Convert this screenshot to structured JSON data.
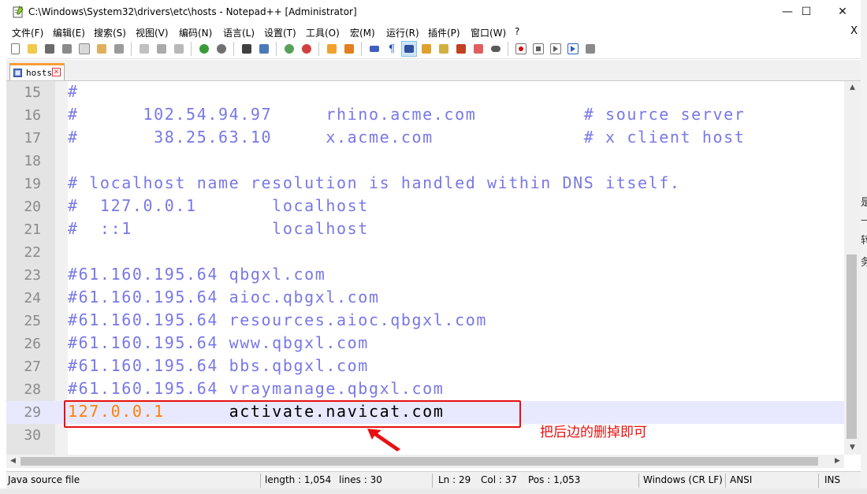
{
  "window": {
    "title": "C:\\Windows\\System32\\drivers\\etc\\hosts - Notepad++ [Administrator]",
    "controls": {
      "minimize": "—",
      "maximize": "☐",
      "close": "✕"
    }
  },
  "menu": {
    "items": [
      "文件(F)",
      "编辑(E)",
      "搜索(S)",
      "视图(V)",
      "编码(N)",
      "语言(L)",
      "设置(T)",
      "工具(O)",
      "宏(M)",
      "运行(R)",
      "插件(P)",
      "窗口(W)",
      "?"
    ],
    "close": "X"
  },
  "toolbar": {
    "icons": [
      "new-icon",
      "open-icon",
      "save-icon",
      "save-all-icon",
      "close-icon",
      "close-all-icon",
      "print-icon",
      "cut-icon",
      "copy-icon",
      "paste-icon",
      "undo-icon",
      "redo-icon",
      "find-icon",
      "replace-icon",
      "zoom-in-icon",
      "zoom-out-icon",
      "sync-v-icon",
      "sync-h-icon",
      "wrap-icon",
      "all-chars-icon",
      "indent-guide-icon",
      "udl-icon",
      "doc-map-icon",
      "function-list-icon",
      "folder-workspace-icon",
      "monitor-icon",
      "record-macro-icon",
      "stop-macro-icon",
      "play-macro-icon",
      "run-macro-icon",
      "save-macro-icon"
    ]
  },
  "tab": {
    "label": "hosts"
  },
  "editor": {
    "current_line": "29",
    "lines": [
      {
        "num": "15",
        "text": "#"
      },
      {
        "num": "16",
        "text": "#      102.54.94.97     rhino.acme.com          # source server"
      },
      {
        "num": "17",
        "text": "#       38.25.63.10     x.acme.com              # x client host"
      },
      {
        "num": "18",
        "text": ""
      },
      {
        "num": "19",
        "text": "# localhost name resolution is handled within DNS itself."
      },
      {
        "num": "20",
        "text": "#  127.0.0.1       localhost"
      },
      {
        "num": "21",
        "text": "#  ::1             localhost"
      },
      {
        "num": "22",
        "text": ""
      },
      {
        "num": "23",
        "text": "#61.160.195.64 qbgxl.com"
      },
      {
        "num": "24",
        "text": "#61.160.195.64 aioc.qbgxl.com"
      },
      {
        "num": "25",
        "text": "#61.160.195.64 resources.aioc.qbgxl.com"
      },
      {
        "num": "26",
        "text": "#61.160.195.64 www.qbgxl.com"
      },
      {
        "num": "27",
        "text": "#61.160.195.64 bbs.qbgxl.com"
      },
      {
        "num": "28",
        "text": "#61.160.195.64 vraymanage.qbgxl.com"
      },
      {
        "num": "29",
        "ip": "127.0.0.1",
        "host": "activate.navicat.com"
      },
      {
        "num": "30",
        "text": ""
      }
    ]
  },
  "annotation": {
    "text": "把后边的删掉即可",
    "color": "#e81010"
  },
  "status": {
    "filetype": "Java source file",
    "length": "length : 1,054",
    "lines": "lines : 30",
    "ln": "Ln : 29",
    "col": "Col : 37",
    "pos": "Pos : 1,053",
    "eol": "Windows (CR LF)",
    "encoding": "ANSI",
    "mode": "INS"
  },
  "colors": {
    "comment": "#7878e6",
    "ip": "#ff8000",
    "text": "#000000",
    "current_line_bg": "#e8e8ff",
    "tab_accent": "#fa9c34"
  }
}
